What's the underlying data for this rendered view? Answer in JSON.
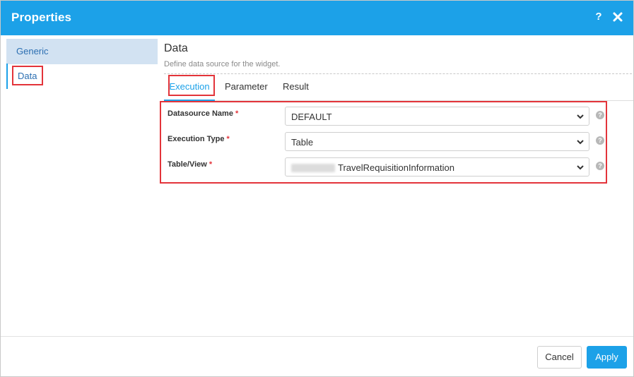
{
  "titlebar": {
    "title": "Properties",
    "help_label": "?",
    "close_icon": "close-icon",
    "bg_color": "#1ca1e8"
  },
  "sidebar": {
    "items": [
      {
        "label": "Generic",
        "selected": false
      },
      {
        "label": "Data",
        "selected": true
      }
    ]
  },
  "main": {
    "title": "Data",
    "description": "Define data source for the widget.",
    "tabs": [
      {
        "label": "Execution",
        "active": true
      },
      {
        "label": "Parameter",
        "active": false
      },
      {
        "label": "Result",
        "active": false
      }
    ],
    "fields": [
      {
        "label": "Datasource Name",
        "required": "*",
        "value": "DEFAULT"
      },
      {
        "label": "Execution Type",
        "required": "*",
        "value": "Table"
      },
      {
        "label": "Table/View",
        "required": "*",
        "value": "TravelRequisitionInformation"
      }
    ],
    "help_mark": "?"
  },
  "footer": {
    "cancel_label": "Cancel",
    "apply_label": "Apply"
  },
  "colors": {
    "accent": "#1ca1e8",
    "highlight": "#e3343a",
    "sidebar_selected_bg": "#d2e2f2"
  }
}
